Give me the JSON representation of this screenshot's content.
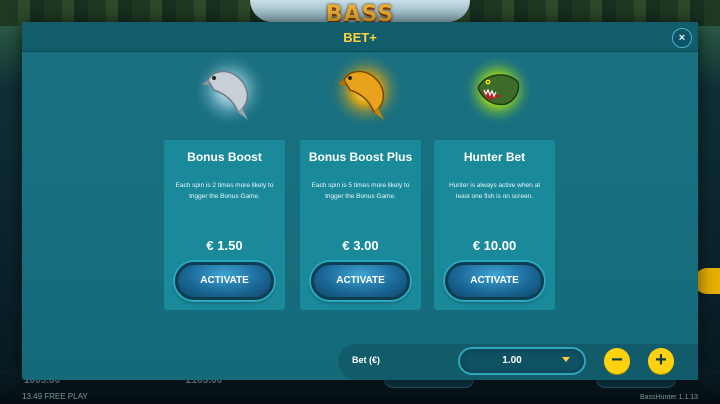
{
  "background": {
    "logo_text": "BASS",
    "left_amount": "1005.00",
    "center_amount": "2103.00",
    "free_play": "13.49 FREE PLAY",
    "version": "BassHunter 1.1.13"
  },
  "modal": {
    "title": "BET+",
    "close_glyph": "×"
  },
  "cards": [
    {
      "title": "Bonus Boost",
      "description": "Each spin is 2 times more likely to trigger the Bonus Game.",
      "price": "€ 1.50",
      "button": "ACTIVATE",
      "icon": "silver-fish-icon",
      "glow": "#dff6ff"
    },
    {
      "title": "Bonus Boost Plus",
      "description": "Each spin is 5 times more likely to trigger the Bonus Game.",
      "price": "€ 3.00",
      "button": "ACTIVATE",
      "icon": "gold-fish-icon",
      "glow": "#ffb000"
    },
    {
      "title": "Hunter Bet",
      "description": "Hunter is always active when at least one fish is on screen.",
      "price": "€ 10.00",
      "button": "ACTIVATE",
      "icon": "hunter-fish-icon",
      "glow": "#d6ff24"
    }
  ],
  "bet": {
    "label": "Bet (€)",
    "value": "1.00",
    "minus": "−",
    "plus": "+"
  },
  "colors": {
    "accent_yellow": "#ffd23c",
    "modal_teal": "#17707f",
    "card_teal": "#1a8a9b"
  }
}
